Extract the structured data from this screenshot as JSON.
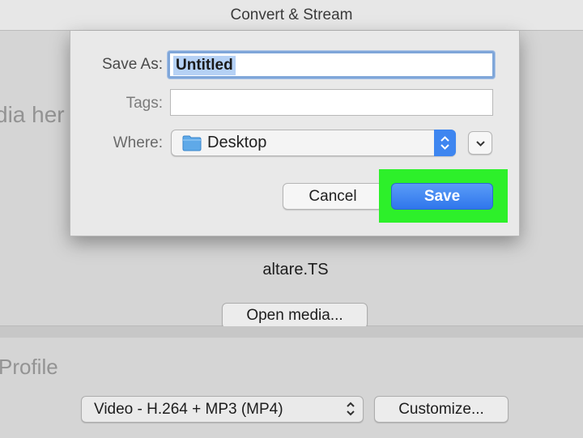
{
  "window": {
    "title": "Convert & Stream",
    "drop_hint": "dia her",
    "file_name": "altare.TS",
    "open_media_label": "Open media...",
    "profile_heading": "Profile",
    "profile_select_value": "Video - H.264 + MP3 (MP4)",
    "customize_label": "Customize..."
  },
  "save_dialog": {
    "save_as_label": "Save As:",
    "save_as_value": "Untitled",
    "tags_label": "Tags:",
    "tags_value": "",
    "where_label": "Where:",
    "where_value": "Desktop",
    "cancel_label": "Cancel",
    "save_label": "Save"
  },
  "colors": {
    "accent": "#3e86f0",
    "highlight": "#2df02a"
  },
  "icons": [
    "folder-icon",
    "updown-chevron-icon",
    "chevron-down-icon"
  ]
}
